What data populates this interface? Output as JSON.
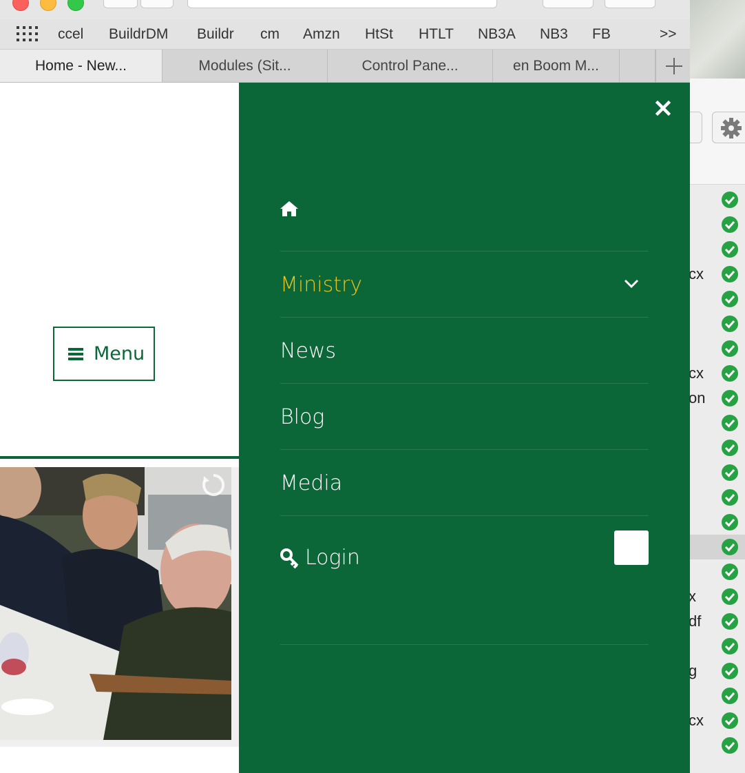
{
  "bookmarks": {
    "items": [
      "ccel",
      "BuildrDM",
      "Buildr",
      "cm",
      "Amzn",
      "HtSt",
      "HTLT",
      "NB3A",
      "NB3",
      "FB"
    ],
    "overflow_label": ">>"
  },
  "tabs": [
    {
      "label": "Home - New..."
    },
    {
      "label": "Modules (Sit..."
    },
    {
      "label": "Control Pane..."
    },
    {
      "label": "en Boom M..."
    }
  ],
  "page": {
    "menu_button_label": "Menu"
  },
  "offcanvas": {
    "close_icon": "close-icon",
    "home_icon": "home-icon",
    "nav": [
      {
        "label": "Ministry",
        "active": true,
        "has_submenu": true
      },
      {
        "label": "News"
      },
      {
        "label": "Blog"
      },
      {
        "label": "Media"
      }
    ],
    "login_label": "Login",
    "login_icon": "key-icon"
  },
  "right_app": {
    "file_fragments": [
      "",
      "",
      "",
      "cx",
      "",
      "",
      "",
      "cx",
      "on",
      "",
      "",
      "",
      "",
      "",
      "",
      "",
      "x",
      "df",
      "",
      "g",
      "",
      "cx",
      ""
    ]
  },
  "colors": {
    "brand_green": "#0b6638",
    "active_nav": "#e8c31f",
    "check_green": "#27a243"
  }
}
